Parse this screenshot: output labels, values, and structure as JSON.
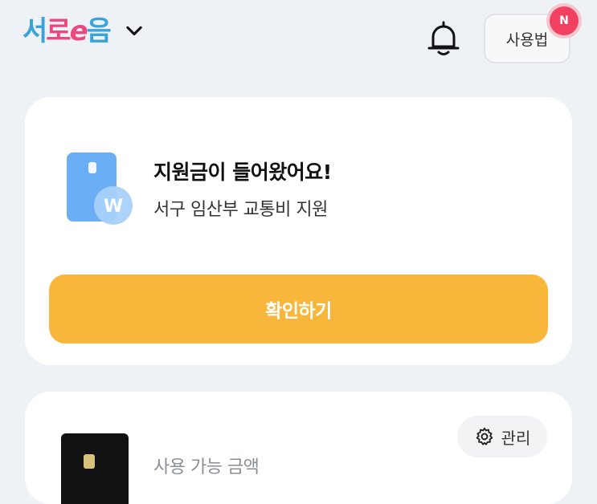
{
  "header": {
    "logo_parts": [
      "서",
      "로",
      "e",
      "음"
    ],
    "help_label": "사용법",
    "notice_badge": "N"
  },
  "notification_card": {
    "title": "지원금이 들어왔어요!",
    "subtitle": "서구 임산부 교통비 지원",
    "confirm_label": "확인하기",
    "currency_symbol": "W"
  },
  "balance_card": {
    "manage_label": "관리",
    "balance_label": "사용 가능 금액"
  },
  "colors": {
    "accent_yellow": "#f8b73a",
    "logo_pink": "#e84a7f",
    "logo_blue": "#3aa3d9",
    "badge_red": "#f24060",
    "card_icon_blue": "#6aaef5"
  }
}
